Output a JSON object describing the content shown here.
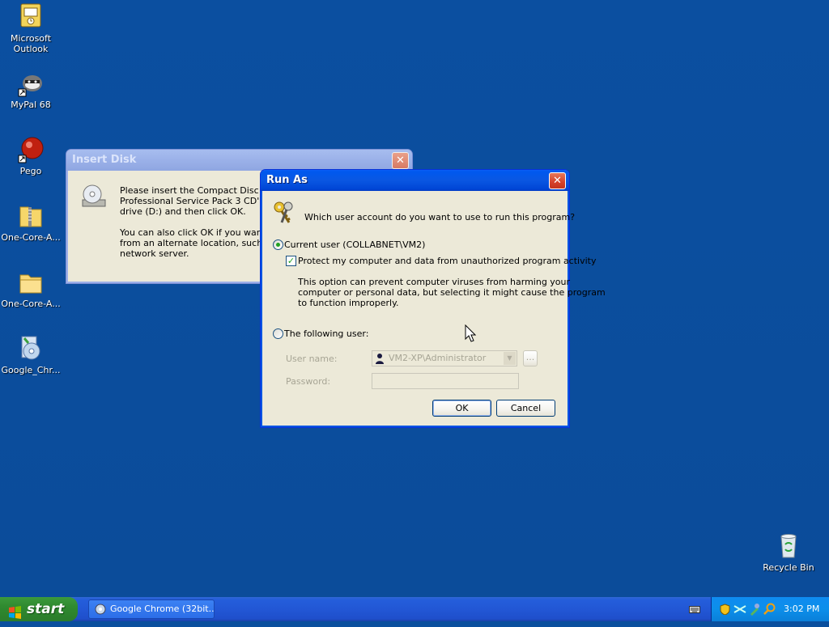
{
  "desktop_icons": [
    {
      "label": "Microsoft Outlook",
      "line1": "Microsoft",
      "line2": "Outlook",
      "icon": "outlook-icon"
    },
    {
      "label": "MyPal 68",
      "icon": "mypal-icon"
    },
    {
      "label": "Pego",
      "icon": "pego-icon"
    },
    {
      "label": "One-Core-A...",
      "icon": "zip-folder-icon"
    },
    {
      "label": "One-Core-A...",
      "icon": "folder-icon"
    },
    {
      "label": "Google_Chr...",
      "icon": "installer-icon"
    },
    {
      "label": "Recycle Bin",
      "icon": "recycle-bin-icon"
    }
  ],
  "insert_disk": {
    "title": "Insert Disk",
    "close": "✕",
    "line1": "Please insert the Compact Disc label",
    "line2": "Professional Service Pack 3 CD' into",
    "line3": "drive (D:) and then click OK.",
    "line4": "You can also click OK if you want file",
    "line5": "from an alternate location, such as a",
    "line6": "network server."
  },
  "run_as": {
    "title": "Run As",
    "close": "✕",
    "question": "Which user account do you want to use to run this program?",
    "current_user_label": "Current user (COLLABNET\\VM2)",
    "protect_label": "Protect my computer and data from unauthorized program activity",
    "warning_line1": "This option can prevent computer viruses from harming your",
    "warning_line2": "computer or personal data, but selecting it might cause the program",
    "warning_line3": "to function improperly.",
    "following_user_label": "The following user:",
    "username_label": "User name:",
    "username_value": "VM2-XP\\Administrator",
    "browse_label": "...",
    "password_label": "Password:",
    "ok_label": "OK",
    "cancel_label": "Cancel",
    "selected_option": "current_user",
    "protect_checked": true
  },
  "taskbar": {
    "start_label": "start",
    "task_label": "Google Chrome (32bit...",
    "clock": "3:02 PM"
  }
}
